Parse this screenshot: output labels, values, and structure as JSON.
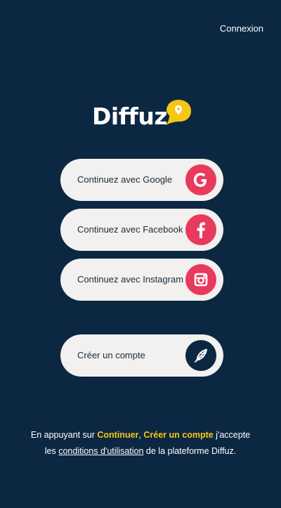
{
  "header": {
    "login_label": "Connexion"
  },
  "logo": {
    "wordmark": "Diffuz"
  },
  "colors": {
    "background": "#0c2742",
    "button_bg": "#f2f1ef",
    "icon_accent": "#e83a5c",
    "highlight": "#f6c615"
  },
  "buttons": [
    {
      "label": "Continuez avec Google",
      "icon": "google-icon"
    },
    {
      "label": "Continuez avec Facebook",
      "icon": "facebook-icon"
    },
    {
      "label": "Continuez avec Instagram",
      "icon": "instagram-icon"
    },
    {
      "label": "Créer un compte",
      "icon": "feather-pen-icon"
    }
  ],
  "footer": {
    "text_1": "En appuyant sur ",
    "highlight_1": "Continuer",
    "text_2": ", ",
    "highlight_2": "Créer un compte",
    "text_3": " j'accepte",
    "text_4": "les ",
    "terms_link": "conditions d'utilisation",
    "text_5": " de la plateforme Diffuz."
  }
}
